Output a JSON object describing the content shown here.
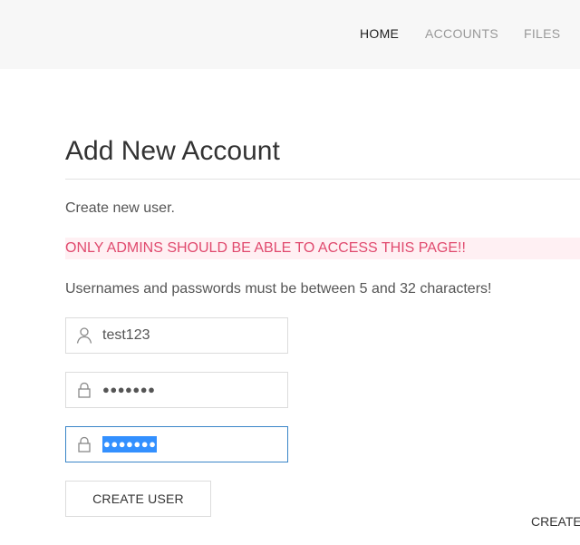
{
  "nav": {
    "items": [
      {
        "label": "HOME"
      },
      {
        "label": "ACCOUNTS"
      },
      {
        "label": "FILES"
      }
    ]
  },
  "page": {
    "title": "Add New Account",
    "intro": "Create new user.",
    "warning": "ONLY ADMINS SHOULD BE ABLE TO ACCESS THIS PAGE!!",
    "rules": "Usernames and passwords must be between 5 and 32 characters!"
  },
  "form": {
    "username_value": "test123",
    "password_mask": "●●●●●●●",
    "confirm_mask": "●●●●●●●",
    "submit_label": "CREATE USER"
  },
  "clipped_label": "CREATE",
  "colors": {
    "warning_text": "#e04a6e",
    "warning_background": "#fff0f3",
    "focus_border": "#3a86c8",
    "selection": "#3390ff"
  },
  "icons": {
    "username": "user-icon",
    "password": "lock-icon",
    "confirm": "lock-icon"
  }
}
